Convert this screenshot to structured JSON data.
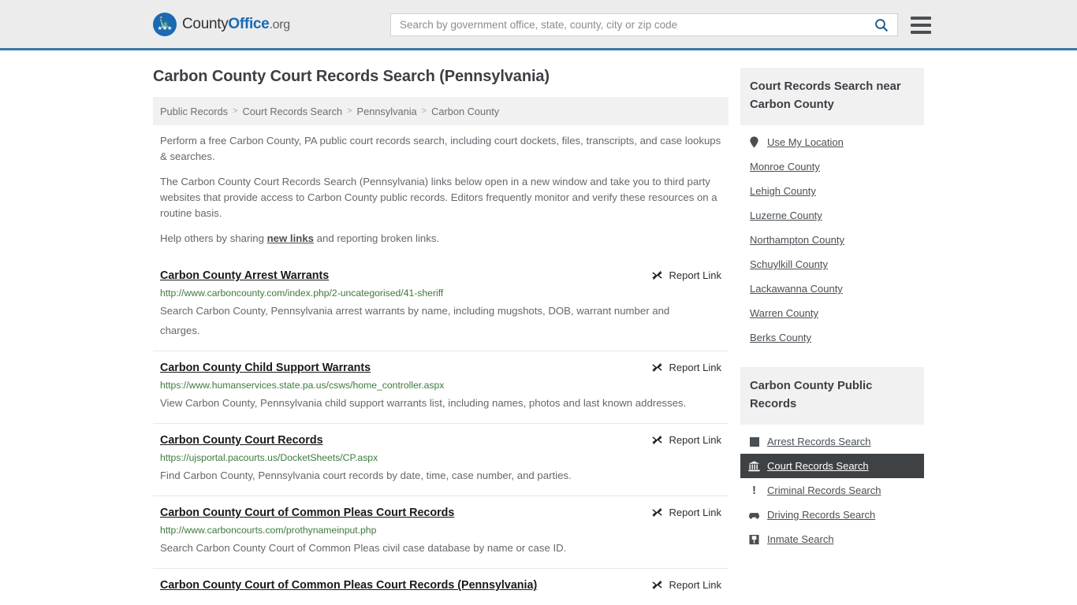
{
  "header": {
    "logo": {
      "part1": "County",
      "part2": "Office",
      "tld": ".org",
      "icon": "eagle-seal-icon"
    },
    "search": {
      "placeholder": "Search by government office, state, county, city or zip code",
      "value": "",
      "button_icon": "search-icon"
    },
    "menu_icon": "hamburger-menu-icon",
    "accent_color": "#3c78a8"
  },
  "main": {
    "page_title": "Carbon County Court Records Search (Pennsylvania)",
    "breadcrumb": {
      "items": [
        "Public Records",
        "Court Records Search",
        "Pennsylvania",
        "Carbon County"
      ],
      "separator": ">"
    },
    "intro": {
      "p1": "Perform a free Carbon County, PA public court records search, including court dockets, files, transcripts, and case lookups & searches.",
      "p2": "The Carbon County Court Records Search (Pennsylvania) links below open in a new window and take you to third party websites that provide access to Carbon County public records. Editors frequently monitor and verify these resources on a routine basis.",
      "p3_before": "Help others by sharing ",
      "p3_link": "new links",
      "p3_after": " and reporting broken links."
    },
    "report_link_label": "Report Link",
    "report_link_icon": "broken-link-icon",
    "results": [
      {
        "title": "Carbon County Arrest Warrants",
        "url": "http://www.carboncounty.com/index.php/2-uncategorised/41-sheriff",
        "description": "Search Carbon County, Pennsylvania arrest warrants by name, including mugshots, DOB, warrant number and charges."
      },
      {
        "title": "Carbon County Child Support Warrants",
        "url": "https://www.humanservices.state.pa.us/csws/home_controller.aspx",
        "description": "View Carbon County, Pennsylvania child support warrants list, including names, photos and last known addresses."
      },
      {
        "title": "Carbon County Court Records",
        "url": "https://ujsportal.pacourts.us/DocketSheets/CP.aspx",
        "description": "Find Carbon County, Pennsylvania court records by date, time, case number, and parties."
      },
      {
        "title": "Carbon County Court of Common Pleas Court Records",
        "url": "http://www.carboncourts.com/prothynameinput.php",
        "description": "Search Carbon County Court of Common Pleas civil case database by name or case ID."
      },
      {
        "title": "Carbon County Court of Common Pleas Court Records (Pennsylvania)",
        "url": "",
        "description": ""
      }
    ]
  },
  "sidebar": {
    "nearby": {
      "heading": "Court Records Search near Carbon County",
      "items": [
        {
          "label": "Use My Location",
          "icon": "map-pin-icon"
        },
        {
          "label": "Monroe County",
          "icon": ""
        },
        {
          "label": "Lehigh County",
          "icon": ""
        },
        {
          "label": "Luzerne County",
          "icon": ""
        },
        {
          "label": "Northampton County",
          "icon": ""
        },
        {
          "label": "Schuylkill County",
          "icon": ""
        },
        {
          "label": "Lackawanna County",
          "icon": ""
        },
        {
          "label": "Warren County",
          "icon": ""
        },
        {
          "label": "Berks County",
          "icon": ""
        }
      ]
    },
    "public_records": {
      "heading": "Carbon County Public Records",
      "items": [
        {
          "label": "Arrest Records Search",
          "icon": "fingerprint-card-icon",
          "active": false
        },
        {
          "label": "Court Records Search",
          "icon": "courthouse-icon",
          "active": true
        },
        {
          "label": "Criminal Records Search",
          "icon": "exclamation-icon",
          "active": false
        },
        {
          "label": "Driving Records Search",
          "icon": "car-icon",
          "active": false
        },
        {
          "label": "Inmate Search",
          "icon": "jail-icon",
          "active": false
        }
      ],
      "active_bg": "#3f4245"
    }
  }
}
